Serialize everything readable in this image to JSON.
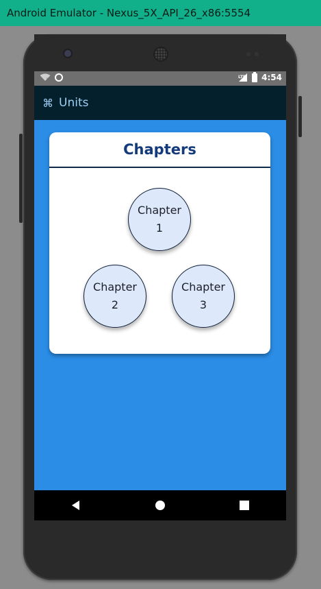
{
  "window": {
    "title": "Android Emulator - Nexus_5X_API_26_x86:5554"
  },
  "status_bar": {
    "time": "4:54",
    "network_badge": "LTE",
    "icons": [
      "wifi-icon",
      "sync-icon",
      "lte-signal-icon",
      "battery-charging-icon"
    ]
  },
  "app_bar": {
    "icon": "command-icon",
    "icon_glyph": "⌘",
    "title": "Units"
  },
  "card": {
    "title": "Chapters",
    "chapters": [
      {
        "label": "Chapter",
        "number": "1"
      },
      {
        "label": "Chapter",
        "number": "2"
      },
      {
        "label": "Chapter",
        "number": "3"
      }
    ]
  },
  "nav_bar": {
    "buttons": [
      "back-icon",
      "home-icon",
      "recents-icon"
    ]
  },
  "colors": {
    "title_bar": "#11b08a",
    "app_bar": "#03202c",
    "app_bar_text": "#9fd0f4",
    "screen_background": "#2b8de6",
    "card_title": "#133a7a",
    "bubble_fill": "#dde8fb"
  }
}
